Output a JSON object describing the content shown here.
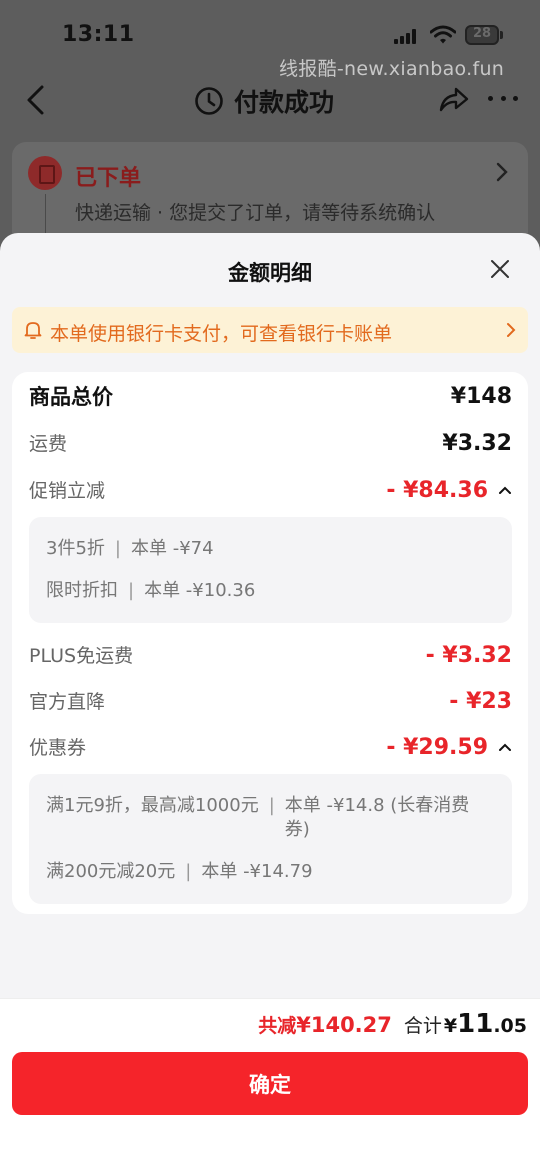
{
  "status_bar": {
    "time": "13:11",
    "battery": "28"
  },
  "watermark": "线报酷-new.xianbao.fun",
  "nav": {
    "title": "付款成功"
  },
  "order": {
    "status": "已下单",
    "desc": "快递运输 · 您提交了订单，请等待系统确认"
  },
  "sheet": {
    "title": "金额明细",
    "notice": "本单使用银行卡支付，可查看银行卡账单",
    "rows": {
      "goods_total": {
        "label": "商品总价",
        "value": "¥148"
      },
      "shipping": {
        "label": "运费",
        "value": "¥3.32"
      },
      "promo": {
        "label": "促销立减",
        "value": "- ¥84.36"
      },
      "plus": {
        "label": "PLUS免运费",
        "value": "- ¥3.32"
      },
      "official": {
        "label": "官方直降",
        "value": "- ¥23"
      },
      "coupon": {
        "label": "优惠券",
        "value": "- ¥29.59"
      }
    },
    "promo_details": [
      {
        "name": "3件5折",
        "amount": "本单 -¥74"
      },
      {
        "name": "限时折扣",
        "amount": "本单 -¥10.36"
      }
    ],
    "coupon_details": [
      {
        "name": "满1元9折，最高减1000元",
        "amount": "本单 -¥14.8 (长春消费券)"
      },
      {
        "name": "满200元减20元",
        "amount": "本单 -¥14.79"
      }
    ]
  },
  "footer": {
    "discount_label": "共减",
    "discount_value": "¥140.27",
    "total_label": "合计",
    "total_yen": "¥",
    "total_int": "11",
    "total_dec": ".05",
    "confirm_label": "确定"
  },
  "colors": {
    "accent_red": "#f5242a",
    "price_red": "#e8252a",
    "notice_orange": "#e26a1e",
    "notice_bg": "#fdf2d6"
  }
}
